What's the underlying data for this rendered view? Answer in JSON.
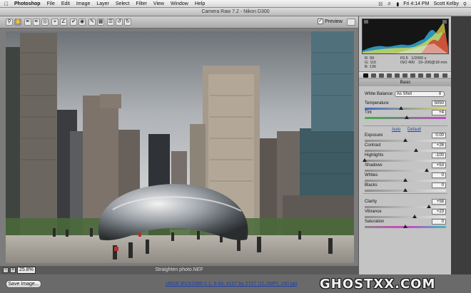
{
  "menubar": {
    "app": "Photoshop",
    "items": [
      "File",
      "Edit",
      "Image",
      "Layer",
      "Select",
      "Filter",
      "View",
      "Window",
      "Help"
    ],
    "clock": "Fri 4:14 PM",
    "user": "Scott Kelby"
  },
  "window": {
    "title": "Camera Raw 7.2  -  Nikon D300"
  },
  "toolbar": {
    "preview_label": "Preview",
    "preview_checked": "✓"
  },
  "histogram": {
    "readout": {
      "r_label": "R:",
      "r": "99",
      "g_label": "G:",
      "g": "115",
      "b_label": "B:",
      "b": "136",
      "aperture": "f/3.5",
      "shutter": "1/2000 s",
      "iso": "ISO 400",
      "lens": "19–200@18 mm"
    }
  },
  "panel": {
    "title": "Basic",
    "white_balance_label": "White Balance:",
    "white_balance_value": "As Shot",
    "auto_label": "Auto",
    "default_label": "Default",
    "sliders": [
      {
        "label": "Temperature",
        "value": "5050",
        "pos": 0.45
      },
      {
        "label": "Tint",
        "value": "+4",
        "pos": 0.52
      },
      {
        "label": "Exposure",
        "value": "0.00",
        "pos": 0.5
      },
      {
        "label": "Contrast",
        "value": "+26",
        "pos": 0.63
      },
      {
        "label": "Highlights",
        "value": "-100",
        "pos": 0.0
      },
      {
        "label": "Shadows",
        "value": "+53",
        "pos": 0.765
      },
      {
        "label": "Whites",
        "value": "0",
        "pos": 0.5
      },
      {
        "label": "Blacks",
        "value": "0",
        "pos": 0.5
      },
      {
        "label": "Clarity",
        "value": "+58",
        "pos": 0.79
      },
      {
        "label": "Vibrance",
        "value": "+23",
        "pos": 0.615
      },
      {
        "label": "Saturation",
        "value": "0",
        "pos": 0.5
      }
    ]
  },
  "zoom": {
    "value": "25.8%",
    "minus": "−",
    "plus": "+"
  },
  "image": {
    "filename": "Straighten photo.NEF"
  },
  "footer": {
    "save_label": "Save Image...",
    "workflow_link": "sRGB IEC61966-2.1; 8 bit; 4107 by 2727 (11.2MP); 240 ppi"
  },
  "watermark": "GHOSTXX.COM"
}
